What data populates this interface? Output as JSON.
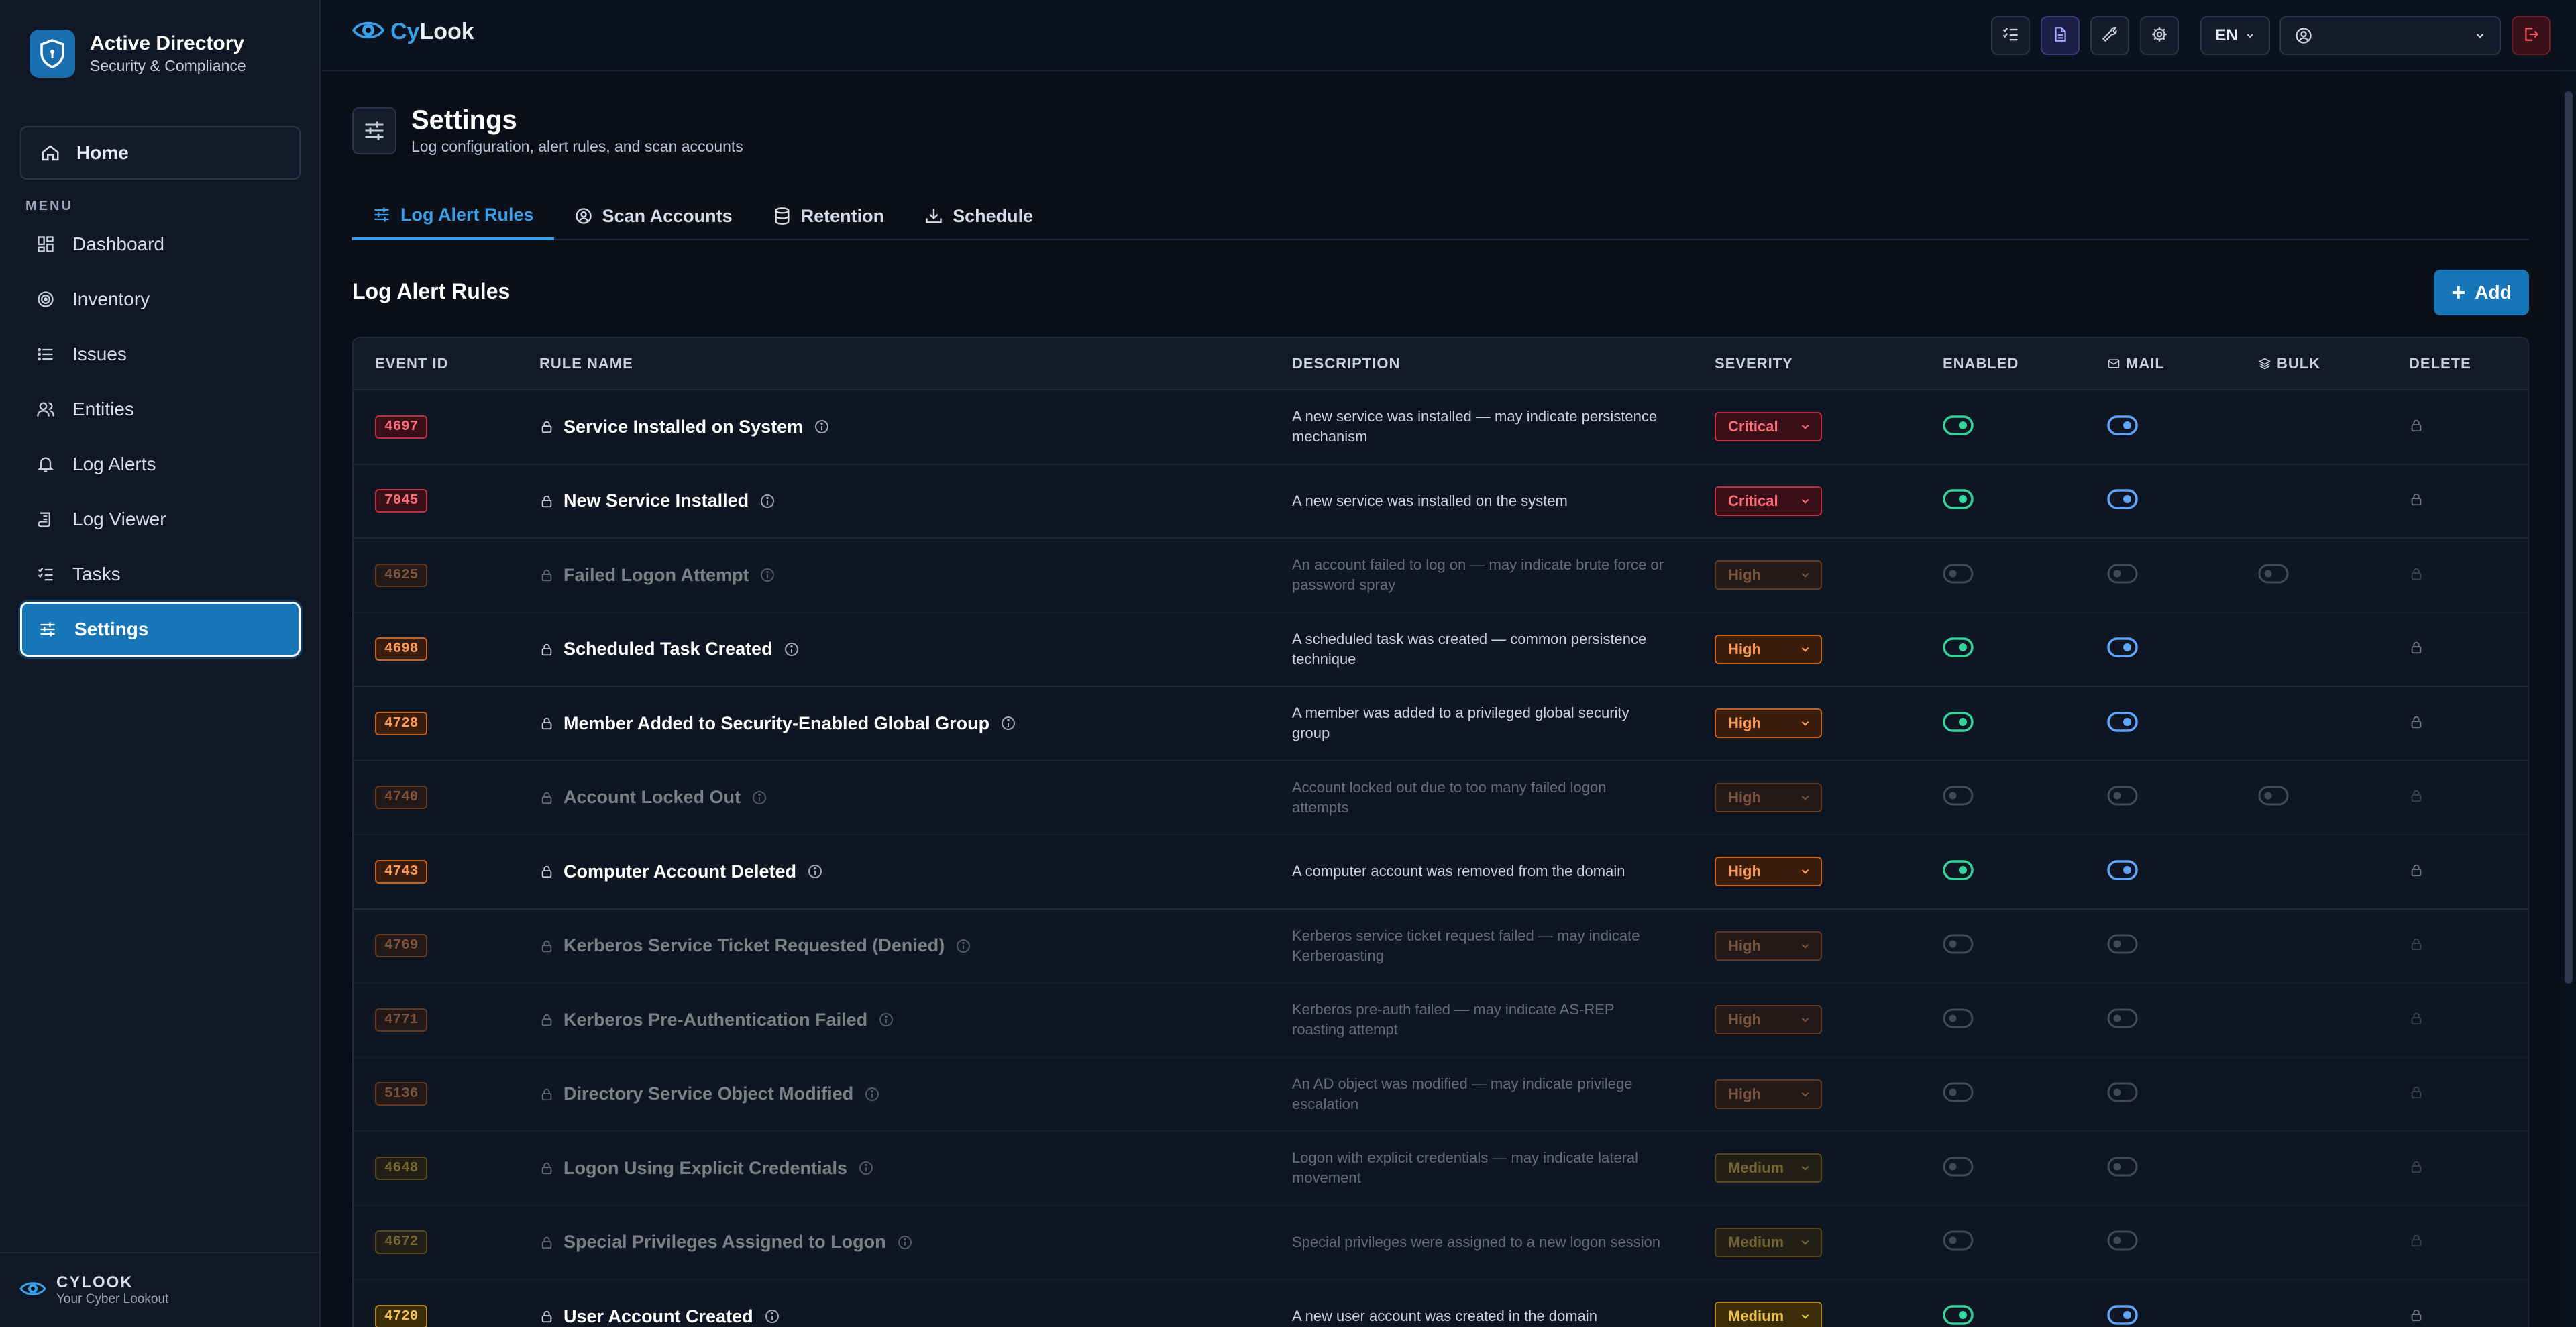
{
  "colors": {
    "accent": "#1676b8",
    "critical": "#ff6a78",
    "high": "#ff9b58",
    "medium": "#f0c048",
    "toggle_enabled_on": "#34d399",
    "toggle_mail_on": "#60a5fa"
  },
  "sidebar": {
    "title": "Active Directory",
    "subtitle": "Security & Compliance",
    "home": "Home",
    "menu_caption": "MENU",
    "items": [
      {
        "label": "Dashboard",
        "icon": "dashboard-icon"
      },
      {
        "label": "Inventory",
        "icon": "target-icon"
      },
      {
        "label": "Issues",
        "icon": "list-icon"
      },
      {
        "label": "Entities",
        "icon": "users-icon"
      },
      {
        "label": "Log Alerts",
        "icon": "bell-icon"
      },
      {
        "label": "Log Viewer",
        "icon": "scroll-icon"
      },
      {
        "label": "Tasks",
        "icon": "checklist-icon"
      },
      {
        "label": "Settings",
        "icon": "sliders-icon",
        "active": true
      }
    ],
    "footer_title": "CYLOOK",
    "footer_subtitle": "Your Cyber Lookout"
  },
  "topbar": {
    "logo_cy": "Cy",
    "logo_look": "Look",
    "language": "EN",
    "user_value": "",
    "buttons": [
      "tasks-icon",
      "document-icon",
      "wrench-icon",
      "gear-icon",
      "logout-icon"
    ]
  },
  "page": {
    "title": "Settings",
    "subtitle": "Log configuration, alert rules, and scan accounts"
  },
  "tabs": [
    {
      "label": "Log Alert Rules",
      "icon": "sliders-icon",
      "active": true
    },
    {
      "label": "Scan Accounts",
      "icon": "user-circle-icon"
    },
    {
      "label": "Retention",
      "icon": "database-icon"
    },
    {
      "label": "Schedule",
      "icon": "download-icon"
    }
  ],
  "section": {
    "title": "Log Alert Rules",
    "add_label": "Add"
  },
  "table": {
    "headers": {
      "event_id": "EVENT ID",
      "rule_name": "RULE NAME",
      "description": "DESCRIPTION",
      "severity": "SEVERITY",
      "enabled": "ENABLED",
      "mail": "MAIL",
      "bulk": "BULK",
      "delete": "DELETE"
    },
    "rows": [
      {
        "event_id": "4697",
        "name": "Service Installed on System",
        "description": "A new service was installed — may indicate persistence mechanism",
        "severity": "Critical",
        "enabled": true,
        "mail": true,
        "bulk": null
      },
      {
        "event_id": "7045",
        "name": "New Service Installed",
        "description": "A new service was installed on the system",
        "severity": "Critical",
        "enabled": true,
        "mail": true,
        "bulk": null
      },
      {
        "event_id": "4625",
        "name": "Failed Logon Attempt",
        "description": "An account failed to log on — may indicate brute force or password spray",
        "severity": "High",
        "enabled": false,
        "mail": false,
        "bulk": false
      },
      {
        "event_id": "4698",
        "name": "Scheduled Task Created",
        "description": "A scheduled task was created — common persistence technique",
        "severity": "High",
        "enabled": true,
        "mail": true,
        "bulk": null
      },
      {
        "event_id": "4728",
        "name": "Member Added to Security-Enabled Global Group",
        "description": "A member was added to a privileged global security group",
        "severity": "High",
        "enabled": true,
        "mail": true,
        "bulk": null
      },
      {
        "event_id": "4740",
        "name": "Account Locked Out",
        "description": "Account locked out due to too many failed logon attempts",
        "severity": "High",
        "enabled": false,
        "mail": false,
        "bulk": false
      },
      {
        "event_id": "4743",
        "name": "Computer Account Deleted",
        "description": "A computer account was removed from the domain",
        "severity": "High",
        "enabled": true,
        "mail": true,
        "bulk": null
      },
      {
        "event_id": "4769",
        "name": "Kerberos Service Ticket Requested (Denied)",
        "description": "Kerberos service ticket request failed — may indicate Kerberoasting",
        "severity": "High",
        "enabled": false,
        "mail": false,
        "bulk": null
      },
      {
        "event_id": "4771",
        "name": "Kerberos Pre-Authentication Failed",
        "description": "Kerberos pre-auth failed — may indicate AS-REP roasting attempt",
        "severity": "High",
        "enabled": false,
        "mail": false,
        "bulk": null
      },
      {
        "event_id": "5136",
        "name": "Directory Service Object Modified",
        "description": "An AD object was modified — may indicate privilege escalation",
        "severity": "High",
        "enabled": false,
        "mail": false,
        "bulk": null
      },
      {
        "event_id": "4648",
        "name": "Logon Using Explicit Credentials",
        "description": "Logon with explicit credentials — may indicate lateral movement",
        "severity": "Medium",
        "enabled": false,
        "mail": false,
        "bulk": null
      },
      {
        "event_id": "4672",
        "name": "Special Privileges Assigned to Logon",
        "description": "Special privileges were assigned to a new logon session",
        "severity": "Medium",
        "enabled": false,
        "mail": false,
        "bulk": null
      },
      {
        "event_id": "4720",
        "name": "User Account Created",
        "description": "A new user account was created in the domain",
        "severity": "Medium",
        "enabled": true,
        "mail": true,
        "bulk": null
      }
    ]
  }
}
